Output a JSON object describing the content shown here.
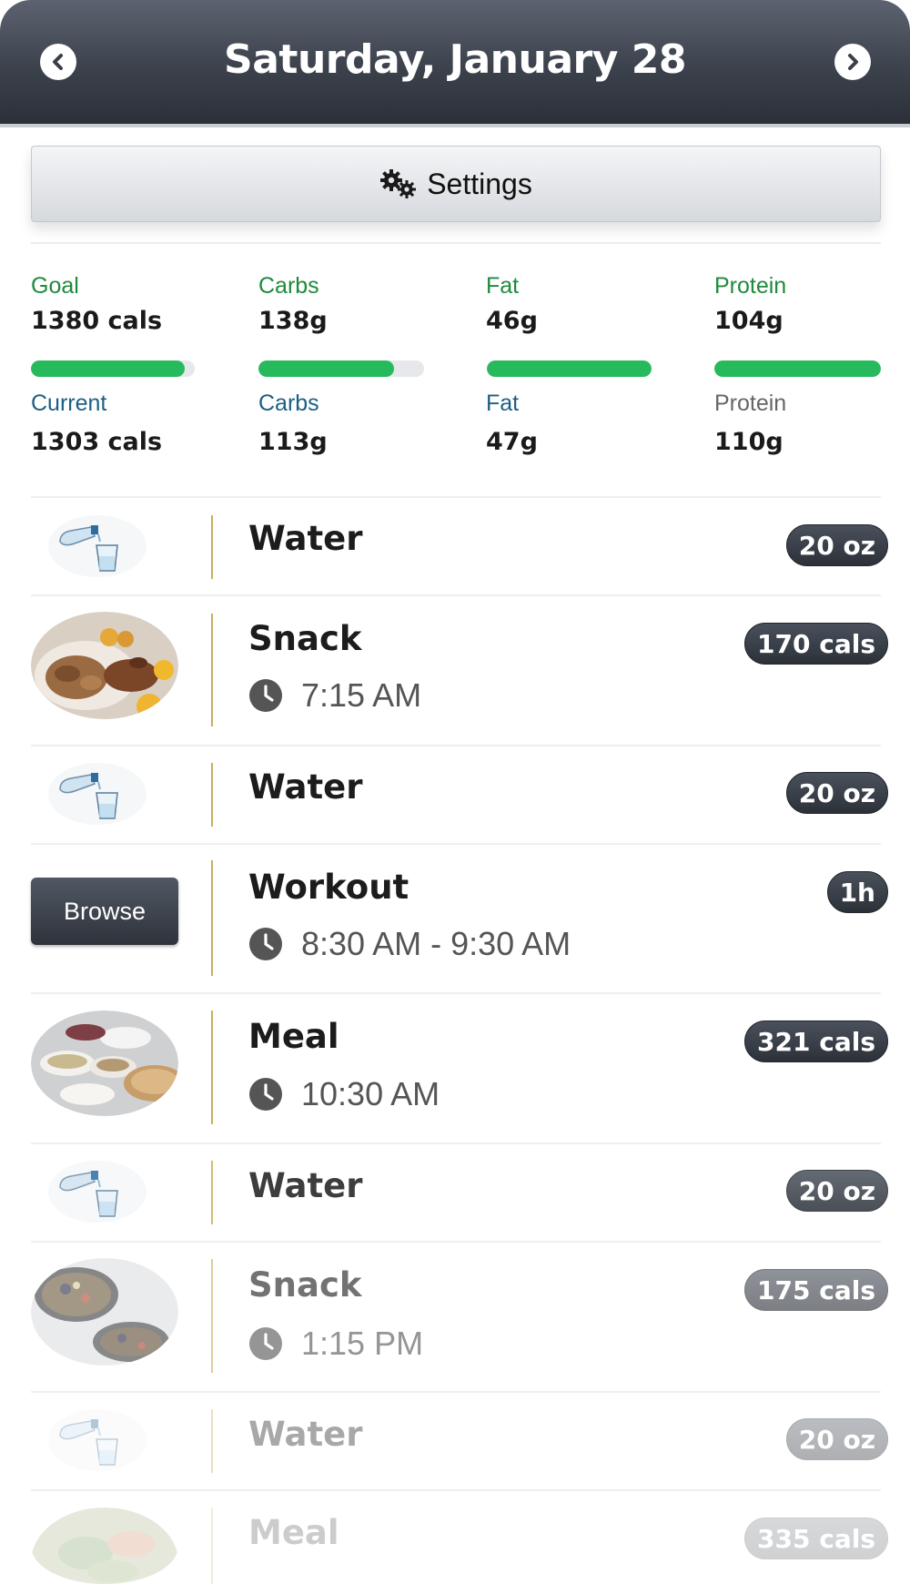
{
  "header": {
    "title": "Saturday, January 28"
  },
  "settings": {
    "label": "Settings"
  },
  "macros": {
    "goal": {
      "label": "Goal",
      "value": "1380 cals",
      "current_label": "Current",
      "current_value": "1303 cals",
      "progress": 0.94
    },
    "carbs": {
      "label": "Carbs",
      "value": "138g",
      "current_label": "Carbs",
      "current_value": "113g",
      "progress": 0.82
    },
    "fat": {
      "label": "Fat",
      "value": "46g",
      "current_label": "Fat",
      "current_value": "47g",
      "progress": 1.0
    },
    "protein": {
      "label": "Protein",
      "value": "104g",
      "current_label": "Protein",
      "current_value": "110g",
      "progress": 1.0
    }
  },
  "colors": {
    "header_dark": "#2b3038",
    "accent_green": "#27ba5c",
    "goal_green": "#1e8a3c",
    "current_teal": "#1c5f84",
    "row_divider_gold": "#c8ae62"
  },
  "entries": [
    {
      "type": "water",
      "title": "Water",
      "badge": "20 oz",
      "icon": "water-glass-icon"
    },
    {
      "type": "snack",
      "title": "Snack",
      "time": "7:15 AM",
      "badge": "170 cals",
      "icon": "snack-photo"
    },
    {
      "type": "water",
      "title": "Water",
      "badge": "20 oz",
      "icon": "water-glass-icon"
    },
    {
      "type": "workout",
      "title": "Workout",
      "time": "8:30 AM - 9:30 AM",
      "badge": "1h",
      "button": "Browse"
    },
    {
      "type": "meal",
      "title": "Meal",
      "time": "10:30 AM",
      "badge": "321 cals",
      "icon": "meal-photo"
    },
    {
      "type": "water",
      "title": "Water",
      "badge": "20 oz",
      "icon": "water-glass-icon"
    },
    {
      "type": "snack",
      "title": "Snack",
      "time": "1:15 PM",
      "badge": "175 cals",
      "icon": "snack-photo"
    },
    {
      "type": "water",
      "title": "Water",
      "badge": "20 oz",
      "icon": "water-glass-icon"
    },
    {
      "type": "meal",
      "title": "Meal",
      "badge": "335 cals",
      "icon": "meal-photo"
    }
  ]
}
